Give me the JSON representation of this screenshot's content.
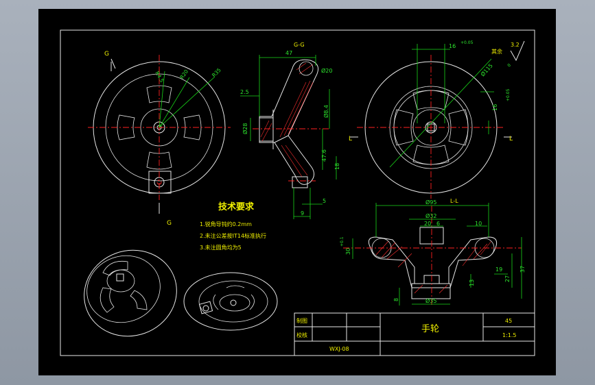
{
  "drawing": {
    "view_labels": {
      "section_gg": "G-G",
      "section_ll": "L-L",
      "mark_g": "G",
      "mark_l": "L"
    },
    "tech_requirements": {
      "title": "技术要求",
      "items": [
        "1.锐角导钝约0.2mm",
        "2.未注公差按IT14标准执行",
        "3.未注圆角均为5"
      ]
    },
    "front_view_dims": [
      "R35",
      "R20",
      "R4.5",
      "R5"
    ],
    "section_gg_dims": [
      "47",
      "Ø20",
      "2.5",
      "Ø28",
      "Ø8.4",
      "47.6",
      "18",
      "5",
      "9"
    ],
    "right_view_dims": [
      "16",
      "+0.05",
      "16",
      "+0.05",
      "Ø115",
      "0",
      "3.2",
      "其余"
    ],
    "section_ll_dims": [
      "Ø95",
      "Ø32",
      "20",
      "6",
      "10",
      "30",
      "+0.1",
      "19",
      "37",
      "27",
      "13",
      "8",
      "Ø35"
    ],
    "title_block": {
      "drawn_by": "制图",
      "checked_by": "校核",
      "part_name": "手轮",
      "material": "45",
      "scale": "1:1.5",
      "drawing_no": "WXJ-08"
    }
  }
}
